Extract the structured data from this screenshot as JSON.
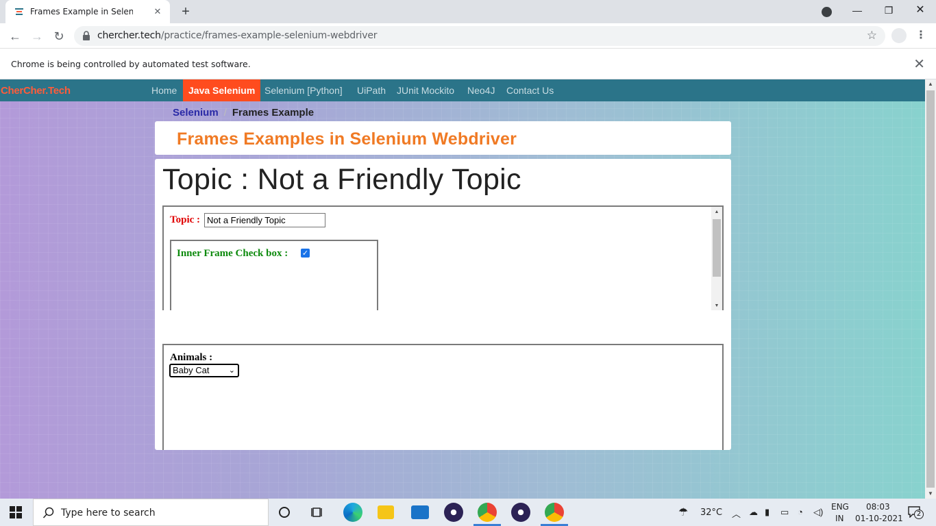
{
  "browser": {
    "tab_title": "Frames Example in Selenium web",
    "tab_close": "✕",
    "new_tab": "+",
    "minimize": "—",
    "restore": "❐",
    "close": "✕",
    "url_domain": "chercher.tech",
    "url_path": "/practice/frames-example-selenium-webdriver",
    "back": "←",
    "forward": "→",
    "reload": "↻",
    "bookmark": "☆",
    "menu": "⋮",
    "infobar_text": "Chrome is being controlled by automated test software.",
    "infobar_close": "✕"
  },
  "site": {
    "brand": "CherCher.Tech",
    "nav": [
      {
        "label": "Home",
        "active": false
      },
      {
        "label": "Java Selenium",
        "active": true
      },
      {
        "label": "Selenium [Python]",
        "active": false
      },
      {
        "label": "UiPath",
        "active": false
      },
      {
        "label": "JUnit Mockito",
        "active": false
      },
      {
        "label": "Neo4J",
        "active": false
      },
      {
        "label": "Contact Us",
        "active": false
      }
    ],
    "breadcrumb": {
      "parent": "Selenium",
      "separator": "/",
      "current": "Frames Example"
    },
    "page_title": "Frames Examples in Selenium Webdriver",
    "topic_heading": "Topic : Not a Friendly Topic"
  },
  "frame1": {
    "topic_label": "Topic :",
    "topic_value": "Not a Friendly Topic",
    "inner_frame": {
      "label": "Inner Frame Check box :",
      "checked": true,
      "check_glyph": "✓"
    }
  },
  "frame2": {
    "animals_label": "Animals :",
    "selected_animal": "Baby Cat",
    "caret": "⌄"
  },
  "taskbar": {
    "search_placeholder": "Type here to search",
    "weather": "32°C",
    "language_top": "ENG",
    "language_bottom": "IN",
    "time": "08:03",
    "date": "01-10-2021",
    "notifications": "2"
  },
  "colors": {
    "nav_bg": "#2b7489",
    "nav_active": "#ff4c1e",
    "brand": "#ff5c3a",
    "title_orange": "#f07a24",
    "topic_red": "#e00000",
    "inner_green": "#0d8a0d",
    "breadcrumb_link": "#2a2aa6"
  }
}
